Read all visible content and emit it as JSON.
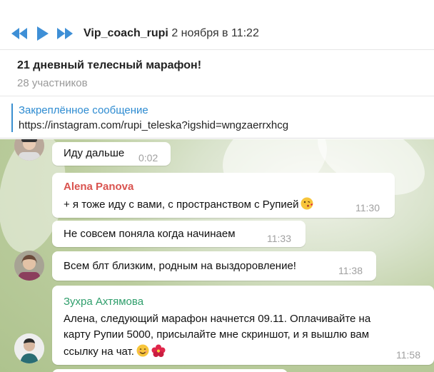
{
  "player": {
    "author": "Vip_coach_rupi",
    "date": "2 ноября в 11:22",
    "controls": [
      "previous-icon",
      "play-icon",
      "next-icon"
    ],
    "accent": "#3e8fd6"
  },
  "chat": {
    "title": "21 дневный телесный марафон!",
    "members": "28 участников"
  },
  "pinned": {
    "title": "Закреплённое сообщение",
    "text": "https://instagram.com/rupi_teleska?igshid=wngzaerrxhcg"
  },
  "messages": [
    {
      "text": "Иду дальше",
      "time": "0:02"
    },
    {
      "author": "Alena Panova",
      "author_color": "#d9534f",
      "text": "+ я тоже иду с вами,  с пространством с Рупией",
      "emoji": "kiss-face-icon",
      "time": "11:30"
    },
    {
      "text": "Не совсем поняла когда начинаем",
      "time": "11:33"
    },
    {
      "text": "Всем блт близким,  родным на выздоровление!",
      "time": "11:38"
    },
    {
      "author": "Зухра Ахтямова",
      "author_color": "#2e9e6b",
      "lines": [
        "Алена, следующий марафон начнется 09.11. Оплачивайте на",
        "карту Рупии 5000, присылайте мне скриншот, и я вышлю вам",
        "ссылку на чат."
      ],
      "emoji": [
        "smile-icon",
        "hibiscus-icon"
      ],
      "time": "11:58"
    }
  ]
}
